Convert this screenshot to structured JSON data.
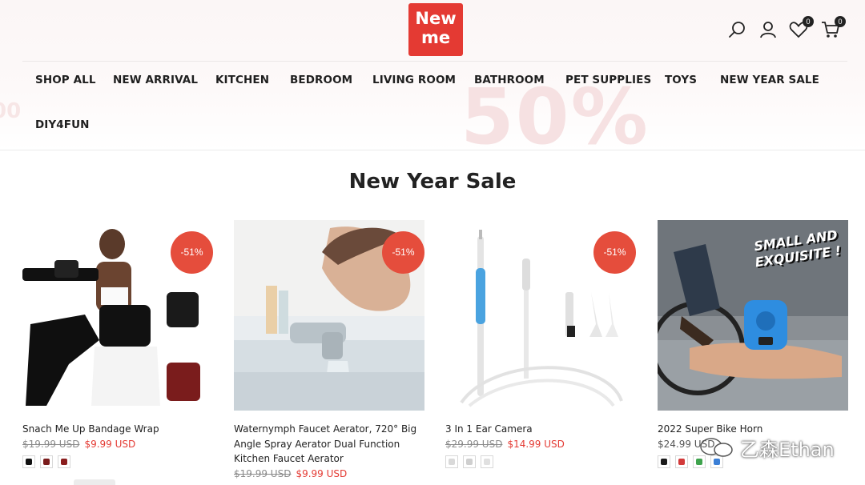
{
  "brand": {
    "logo_line1": "New",
    "logo_line2": "me"
  },
  "header": {
    "wishlist_count": "0",
    "cart_count": "0",
    "promo_background_text": "50%",
    "promo_background_left": "00"
  },
  "nav": {
    "items": [
      "SHOP ALL",
      "NEW ARRIVAL",
      "KITCHEN",
      "BEDROOM",
      "LIVING ROOM",
      "BATHROOM",
      "PET SUPPLIES",
      "TOYS",
      "NEW YEAR SALE",
      "DIY4FUN"
    ]
  },
  "section": {
    "title": "New Year Sale"
  },
  "products": [
    {
      "name": "Snach Me Up Bandage Wrap",
      "discount": "-51%",
      "old_price": "$19.99 USD",
      "price": "$9.99 USD",
      "swatches": [
        "#111111",
        "#7a1c1c",
        "#8a1e1e"
      ]
    },
    {
      "name": "Waternymph Faucet Aerator, 720° Big Angle Spray Aerator Dual Function Kitchen Faucet Aerator",
      "discount": "-51%",
      "old_price": "$19.99 USD",
      "price": "$9.99 USD",
      "swatches": []
    },
    {
      "name": "3 In 1 Ear Camera",
      "discount": "-51%",
      "old_price": "$29.99 USD",
      "price": "$14.99 USD",
      "swatches": [
        "#d9d9d9",
        "#cfcfcf",
        "#e0e0e0"
      ]
    },
    {
      "name": "2022 Super Bike Horn",
      "discount": "",
      "old_price": "",
      "price": "$24.99 USD",
      "image_text_1": "SMALL AND",
      "image_text_2": "EXQUISITE !",
      "swatches": [
        "#1a1a1a",
        "#d23a3a",
        "#3fa34d",
        "#3b7fd6"
      ]
    }
  ],
  "watermark": {
    "text": "乙森Ethan"
  },
  "colors": {
    "brand_red": "#e43a33",
    "discount_badge": "#e54d3c",
    "sale_price": "#e43a33"
  }
}
